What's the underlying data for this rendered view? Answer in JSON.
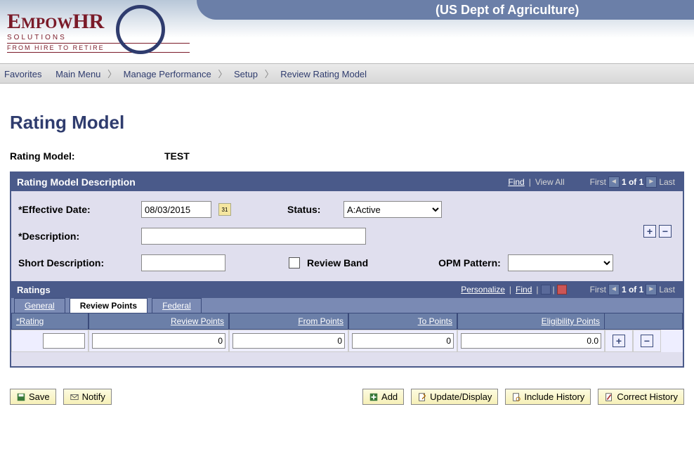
{
  "banner": {
    "org": "(US Dept of Agriculture)",
    "logo_main": "EmpowHR",
    "logo_sub1": "SOLUTIONS",
    "logo_sub2": "FROM HIRE TO RETIRE"
  },
  "breadcrumb": {
    "items": [
      "Favorites",
      "Main Menu",
      "Manage Performance",
      "Setup",
      "Review Rating Model"
    ]
  },
  "page": {
    "title": "Rating Model",
    "model_label": "Rating Model:",
    "model_value": "TEST"
  },
  "desc_section": {
    "title": "Rating Model Description",
    "find": "Find",
    "view_all": "View All",
    "first": "First",
    "counter": "1 of 1",
    "last": "Last",
    "eff_date_label": "*Effective Date:",
    "eff_date_value": "08/03/2015",
    "status_label": "Status:",
    "status_value": "A:Active",
    "desc_label": "*Description:",
    "desc_value": "",
    "short_desc_label": "Short Description:",
    "short_desc_value": "",
    "review_band_label": "Review Band",
    "opm_label": "OPM Pattern:",
    "opm_value": ""
  },
  "ratings_section": {
    "title": "Ratings",
    "personalize": "Personalize",
    "find": "Find",
    "first": "First",
    "counter": "1 of 1",
    "last": "Last",
    "tabs": [
      "General",
      "Review Points",
      "Federal"
    ],
    "active_tab": 1,
    "columns": [
      "*Rating",
      "Review Points",
      "From Points",
      "To Points",
      "Eligibility Points"
    ],
    "row": {
      "rating": "",
      "review_points": "0",
      "from_points": "0",
      "to_points": "0",
      "eligibility_points": "0.0"
    }
  },
  "buttons": {
    "save": "Save",
    "notify": "Notify",
    "add": "Add",
    "update": "Update/Display",
    "include": "Include History",
    "correct": "Correct History"
  }
}
